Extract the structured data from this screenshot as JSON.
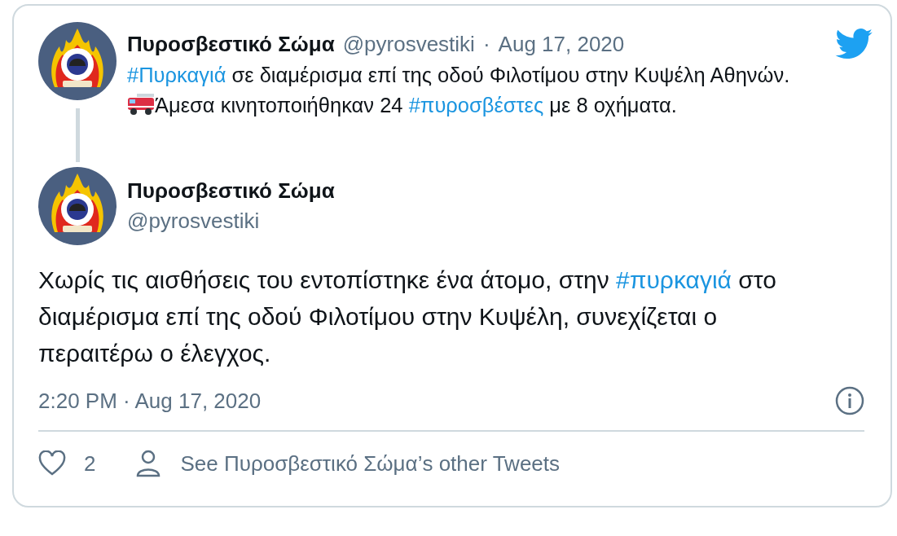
{
  "parent_tweet": {
    "author": "Πυροσβεστικό Σώμα",
    "handle": "@pyrosvestiki",
    "separator": "·",
    "date": "Aug 17, 2020",
    "body": [
      {
        "kind": "hashtag",
        "text": "#Πυρκαγιά"
      },
      {
        "kind": "text",
        "text": " σε διαμέρισμα επί της οδού Φιλοτίμου στην Κυψέλη Αθηνών.\n"
      },
      {
        "kind": "truck"
      },
      {
        "kind": "text",
        "text": "Άμεσα κινητοποιήθηκαν 24 "
      },
      {
        "kind": "hashtag",
        "text": "#πυροσβέστες"
      },
      {
        "kind": "text",
        "text": " με 8 οχήματα."
      }
    ]
  },
  "tweet": {
    "author": "Πυροσβεστικό Σώμα",
    "handle": "@pyrosvestiki",
    "body": [
      {
        "kind": "text",
        "text": "Χωρίς τις αισθήσεις του εντοπίστηκε ένα άτομο, στην "
      },
      {
        "kind": "hashtag",
        "text": "#πυρκαγιά"
      },
      {
        "kind": "text",
        "text": " στο διαμέρισμα επί της οδού Φιλοτίμου στην Κυψέλη, συνεχίζεται ο περαιτέρω ο έλεγχος."
      }
    ],
    "timestamp": "2:20 PM · Aug 17, 2020"
  },
  "footer": {
    "likes": "2",
    "profile_link": "See Πυροσβεστικό Σώμα’s other Tweets"
  }
}
